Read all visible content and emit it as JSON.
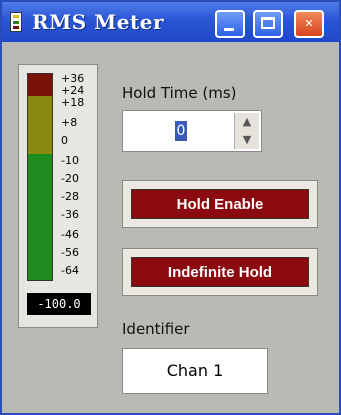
{
  "window": {
    "title": "RMS Meter",
    "controls": {
      "minimize": "minimize-icon",
      "maximize": "maximize-icon",
      "close": "close-icon"
    }
  },
  "meter": {
    "scale_labels": [
      "+36",
      "+24",
      "+18",
      "+8",
      "0",
      "-10",
      "-20",
      "-28",
      "-36",
      "-46",
      "-56",
      "-64"
    ],
    "readout": "-100.0",
    "colors": {
      "red": "#7a1208",
      "yellow": "#8a8a10",
      "green": "#1e8c1e"
    }
  },
  "hold_time": {
    "label": "Hold Time (ms)",
    "value": "0"
  },
  "buttons": {
    "hold_enable": "Hold Enable",
    "indefinite_hold": "Indefinite Hold"
  },
  "identifier": {
    "label": "Identifier",
    "value": "Chan 1"
  },
  "colors": {
    "button_face": "#8b0a10",
    "title_bar": "#2a56d6"
  }
}
